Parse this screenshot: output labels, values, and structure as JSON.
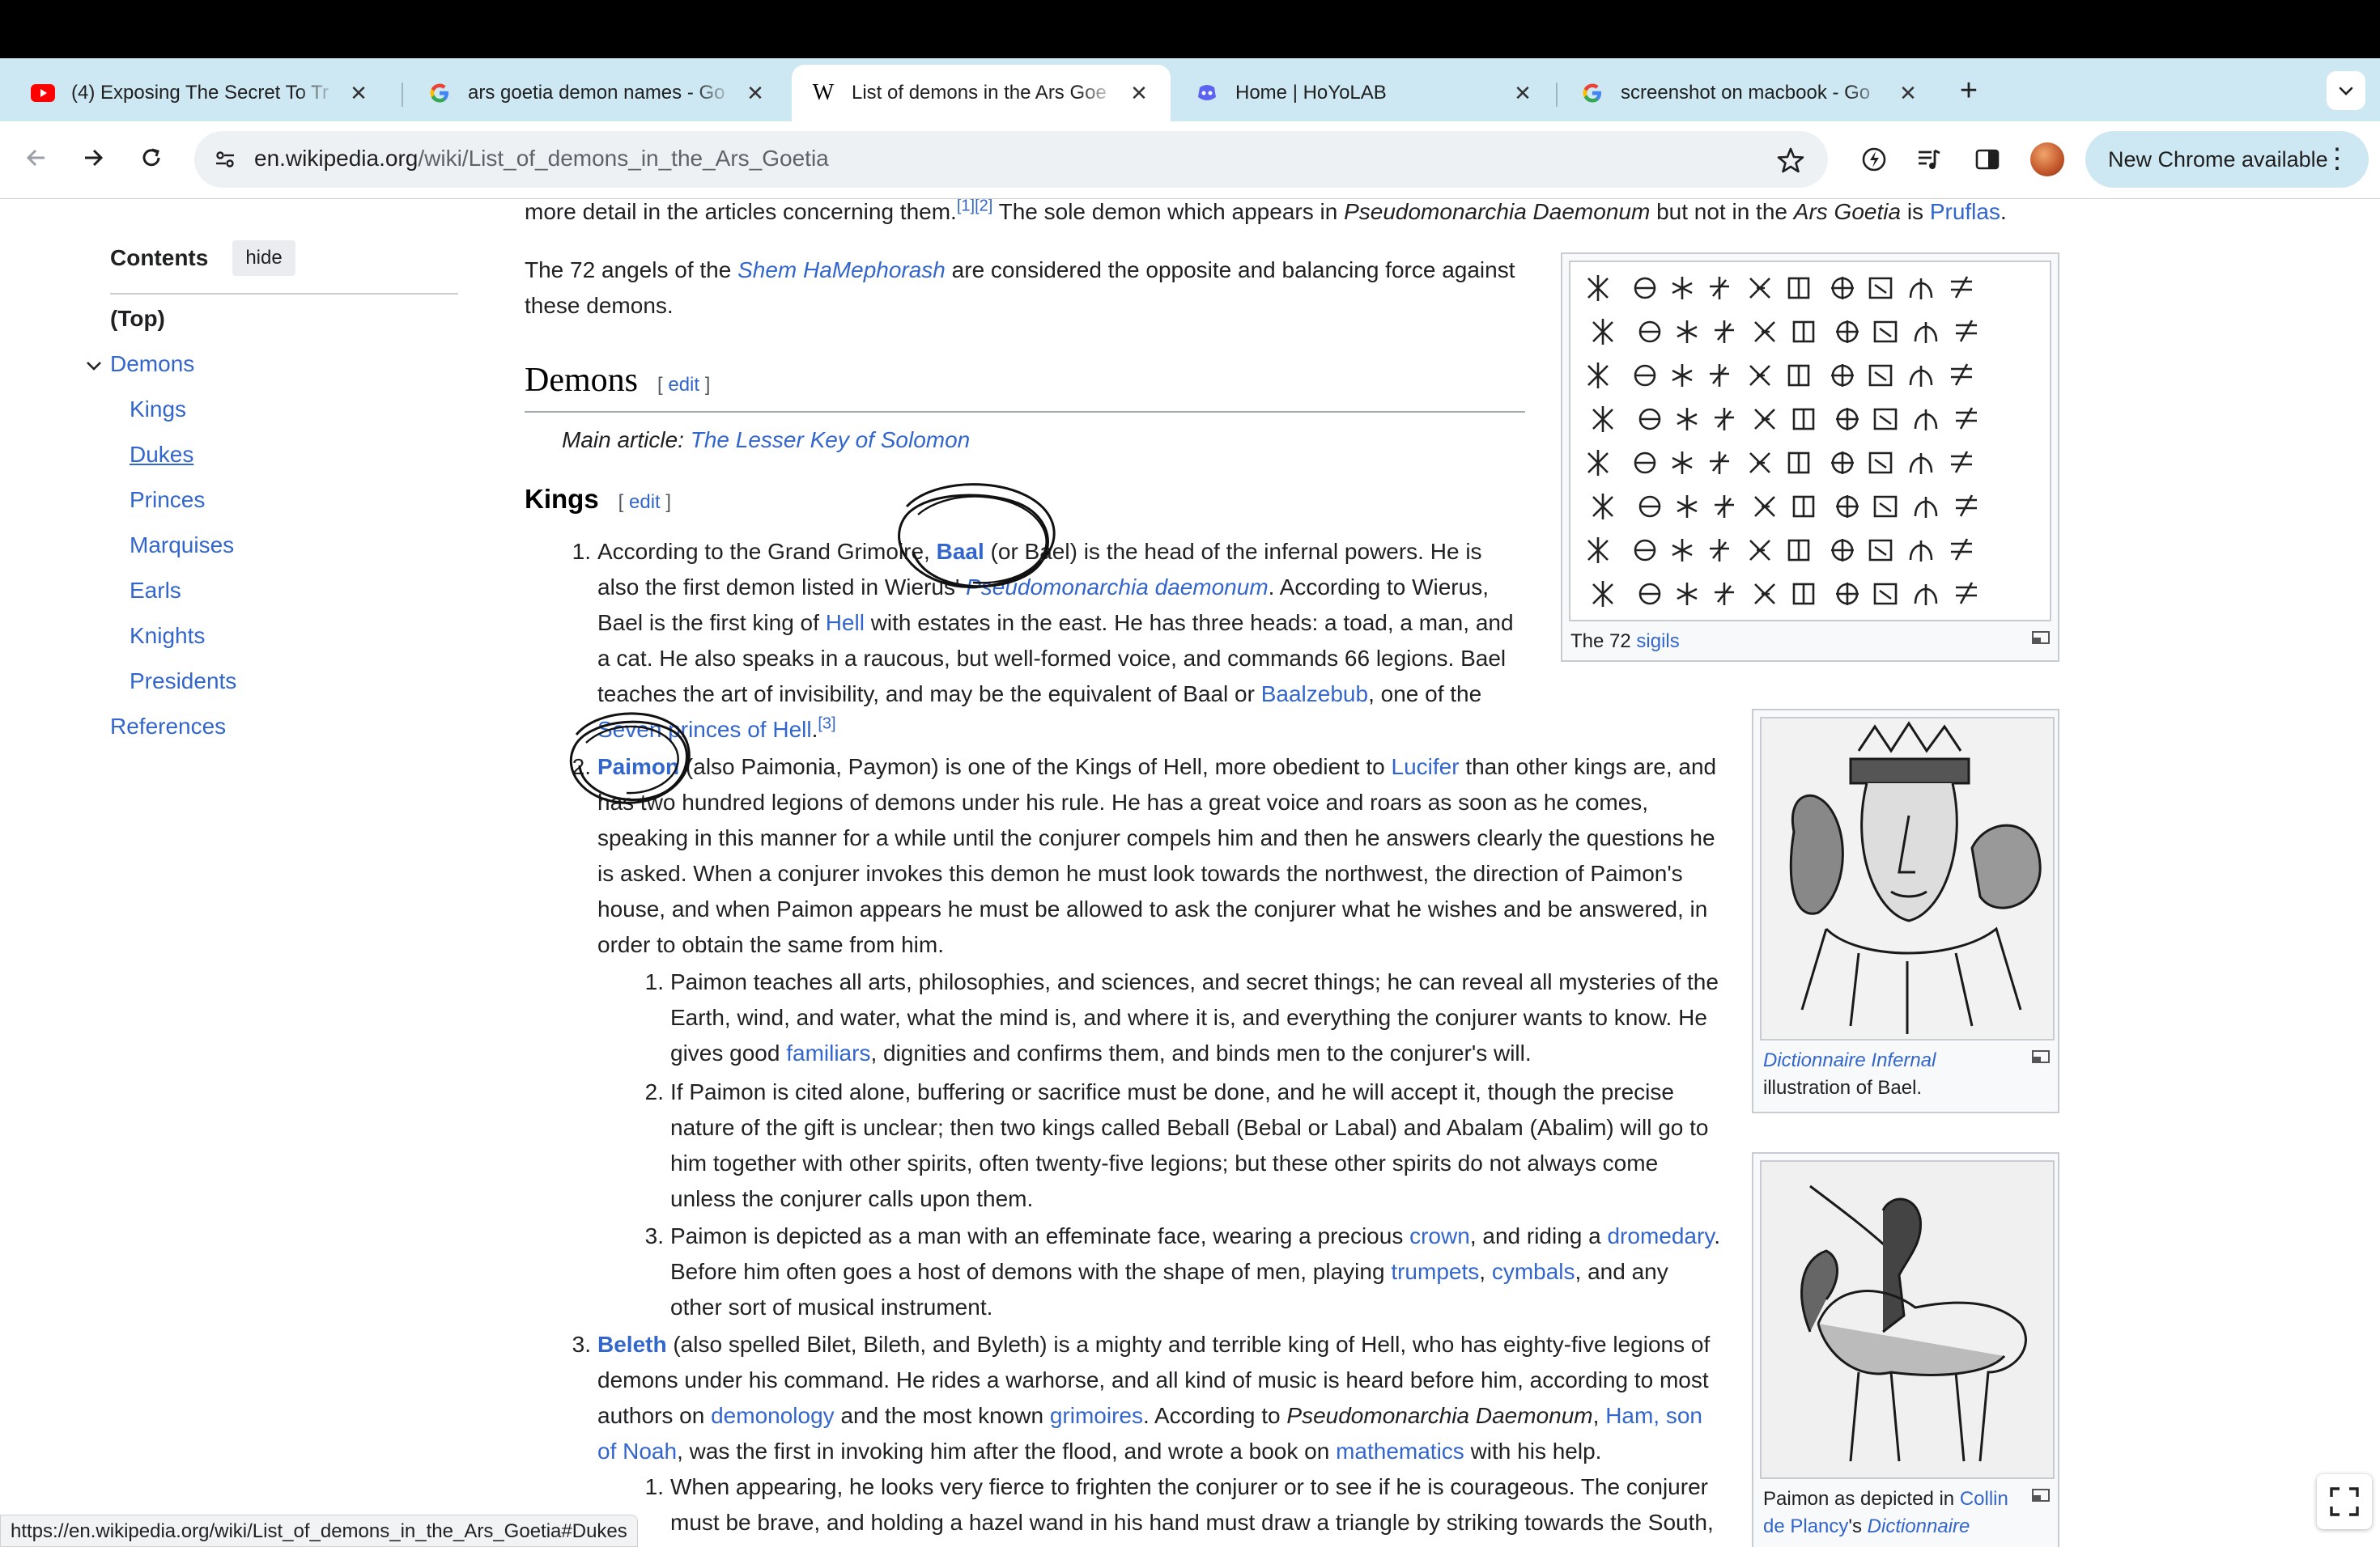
{
  "browser": {
    "tabs": [
      {
        "title": "(4) Exposing The Secret To Tr",
        "icon": "youtube-icon"
      },
      {
        "title": "ars goetia demon names - Go",
        "icon": "google-icon"
      },
      {
        "title": "List of demons in the Ars Goe",
        "icon": "wikipedia-icon",
        "active": true
      },
      {
        "title": "Home | HoYoLAB",
        "icon": "hoyolab-icon"
      },
      {
        "title": "screenshot on macbook - Go",
        "icon": "google-icon"
      }
    ],
    "new_tab_label": "+",
    "url_host": "en.wikipedia.org",
    "url_path": "/wiki/List_of_demons_in_the_Ars_Goetia",
    "update_button_label": "New Chrome available",
    "status_url": "https://en.wikipedia.org/wiki/List_of_demons_in_the_Ars_Goetia#Dukes"
  },
  "toc": {
    "title": "Contents",
    "hide_label": "hide",
    "items": [
      "(Top)",
      "Demons",
      "Kings",
      "Dukes",
      "Princes",
      "Marquises",
      "Earls",
      "Knights",
      "Presidents",
      "References"
    ]
  },
  "article": {
    "intro_line": {
      "a": "more detail in the articles concerning them.",
      "ref1": "[1]",
      "ref2": "[2]",
      "b": " The sole demon which appears in ",
      "i1": "Pseudomonarchia Daemonum",
      "c": " but not in the ",
      "i2": "Ars Goetia",
      "d": " is ",
      "link": "Pruflas",
      "e": "."
    },
    "angels": {
      "a": "The 72 angels of the ",
      "link": "Shem HaMephorash",
      "b": " are considered the opposite and balancing force against",
      "line2": "these demons."
    },
    "demons_heading": "Demons",
    "edit_label": "edit",
    "main_article_prefix": "Main article: ",
    "main_article_link": "The Lesser Key of Solomon",
    "kings_heading": "Kings",
    "baal": {
      "n": "1.",
      "l1a": "According to the Grand Grimoire, ",
      "l1name": "Baal",
      "l1b": " (or Bael) is the head of the infernal powers. He is",
      "l2a": "also the first demon listed in Wierus' ",
      "l2link": "Pseudomonarchia daemonum",
      "l2b": ". According to Wierus,",
      "l3a": "Bael is the first king of ",
      "l3link": "Hell",
      "l3b": " with estates in the east. He has three heads: a toad, a man, and",
      "l4": "a cat. He also speaks in a raucous, but well-formed voice, and commands 66 legions. Bael",
      "l5a": "teaches the art of invisibility, and may be the equivalent of Baal or ",
      "l5link": "Baalzebub",
      "l5b": ", one of the",
      "l6link": "Seven princes of Hell",
      "l6b": ".",
      "l6ref": "[3]"
    },
    "paimon": {
      "n": "2.",
      "l1name": "Paimon",
      "l1a": " (also Paimonia, Paymon) is one of the Kings of Hell, more obedient to ",
      "l1link": "Lucifer",
      "l1b": " than other kings are, and",
      "l2": "has two hundred legions of demons under his rule. He has a great voice and roars as soon as he comes,",
      "l3": "speaking in this manner for a while until the conjurer compels him and then he answers clearly the questions he",
      "l4": "is asked. When a conjurer invokes this demon he must look towards the northwest, the direction of Paimon's",
      "l5": "house, and when Paimon appears he must be allowed to ask the conjurer what he wishes and be answered, in",
      "l6": "order to obtain the same from him.",
      "s1n": "1.",
      "s1l1": "Paimon teaches all arts, philosophies, and sciences, and secret things; he can reveal all mysteries of the",
      "s1l2": "Earth, wind, and water, what the mind is, and where it is, and everything the conjurer wants to know. He",
      "s1l3a": "gives good ",
      "s1l3link": "familiars",
      "s1l3b": ", dignities and confirms them, and binds men to the conjurer's will.",
      "s2n": "2.",
      "s2l1": "If Paimon is cited alone, buffering or sacrifice must be done, and he will accept it, though the precise",
      "s2l2": "nature of the gift is unclear; then two kings called Beball (Bebal or Labal) and Abalam (Abalim) will go to",
      "s2l3": "him together with other spirits, often twenty-five legions; but these other spirits do not always come",
      "s2l4": "unless the conjurer calls upon them.",
      "s3n": "3.",
      "s3l1a": "Paimon is depicted as a man with an effeminate face, wearing a precious ",
      "s3l1link1": "crown",
      "s3l1b": ", and riding a ",
      "s3l1link2": "dromedary",
      "s3l1c": ".",
      "s3l2a": "Before him often goes a host of demons with the shape of men, playing ",
      "s3l2link1": "trumpets",
      "s3l2b": ", ",
      "s3l2link2": "cymbals",
      "s3l2c": ", and any",
      "s3l3": "other sort of musical instrument."
    },
    "beleth": {
      "n": "3.",
      "l1name": "Beleth",
      "l1a": " (also spelled Bilet, Bileth, and Byleth) is a mighty and terrible king of Hell, who has eighty-five legions of",
      "l2": "demons under his command. He rides a warhorse, and all kind of music is heard before him, according to most",
      "l3a": "authors on ",
      "l3link1": "demonology",
      "l3b": " and the most known ",
      "l3link2": "grimoires",
      "l3c": ". According to ",
      "l3i": "Pseudomonarchia Daemonum",
      "l3d": ", ",
      "l3link3": "Ham, son",
      "l4link": "of Noah",
      "l4a": ", was the first in invoking him after the flood, and wrote a book on ",
      "l4link2": "mathematics",
      "l4b": " with his help.",
      "s1n": "1.",
      "s1l1": "When appearing, he looks very fierce to frighten the conjurer or to see if he is courageous. The conjurer",
      "s1l2": "must be brave, and holding a hazel wand in his hand must draw a triangle by striking towards the South,"
    },
    "figures": {
      "sigils_caption_a": "The 72 ",
      "sigils_caption_link": "sigils",
      "bael_caption_i": "Dictionnaire Infernal",
      "bael_caption_b": "illustration of Bael.",
      "paimon_caption_a": "Paimon as depicted in ",
      "paimon_caption_link": "Collin",
      "paimon_caption_line2_link": "de Plancy",
      "paimon_caption_line2_b": "'s ",
      "paimon_caption_line2_i": "Dictionnaire"
    }
  },
  "colors": {
    "link": "#3366cc",
    "tabstrip": "#cde8f2",
    "text": "#202122"
  }
}
